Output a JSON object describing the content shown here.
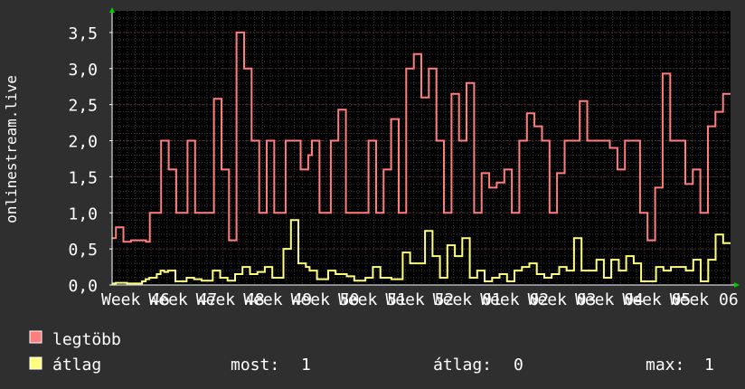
{
  "colors": {
    "background": "#2f2f2f",
    "plot_background": "#000000",
    "grid_minor": "#3a3a3a",
    "grid_major": "#4e2e2e",
    "axis": "#ffffff",
    "arrow": "#00cc00",
    "series_max": "#ff7d7d",
    "series_avg": "#ffff7d"
  },
  "chart_data": {
    "type": "line",
    "ylabel": "onlinestream.live",
    "ylim": [
      0,
      3.8
    ],
    "yticks": [
      {
        "value": 0.0,
        "label": "0,0"
      },
      {
        "value": 0.5,
        "label": "0,5"
      },
      {
        "value": 1.0,
        "label": "1,0"
      },
      {
        "value": 1.5,
        "label": "1,5"
      },
      {
        "value": 2.0,
        "label": "2,0"
      },
      {
        "value": 2.5,
        "label": "2,5"
      },
      {
        "value": 3.0,
        "label": "3,0"
      },
      {
        "value": 3.5,
        "label": "3,5"
      }
    ],
    "xticks": [
      "Week 46",
      "Week 47",
      "Week 48",
      "Week 49",
      "Week 50",
      "Week 51",
      "Week 52",
      "Week 01",
      "Week 02",
      "Week 03",
      "Week 04",
      "Week 05",
      "Week 06"
    ],
    "series": [
      {
        "name": "legtöbb",
        "color": "#ff7d7d",
        "values": [
          0.65,
          0.8,
          0.8,
          0.6,
          0.6,
          0.62,
          0.62,
          0.62,
          0.62,
          0.6,
          1.0,
          1.0,
          1.0,
          2.0,
          2.0,
          1.6,
          1.6,
          1.0,
          1.0,
          1.0,
          2.0,
          2.0,
          1.0,
          1.0,
          1.0,
          1.0,
          1.0,
          2.58,
          2.58,
          1.6,
          1.6,
          0.62,
          0.62,
          3.5,
          3.5,
          3.0,
          3.0,
          2.0,
          2.0,
          1.0,
          1.0,
          2.0,
          2.0,
          1.0,
          1.0,
          1.0,
          2.0,
          2.0,
          2.0,
          2.0,
          1.6,
          1.6,
          1.8,
          2.0,
          2.0,
          1.0,
          1.0,
          1.0,
          2.0,
          2.0,
          2.43,
          2.43,
          1.0,
          1.0,
          1.0,
          1.0,
          1.0,
          1.0,
          2.0,
          2.0,
          1.0,
          1.0,
          1.6,
          1.6,
          2.3,
          2.3,
          1.0,
          1.0,
          3.0,
          3.0,
          3.2,
          3.2,
          2.6,
          2.6,
          3.0,
          3.0,
          2.0,
          2.0,
          1.0,
          1.0,
          2.65,
          2.65,
          2.0,
          2.0,
          2.8,
          2.8,
          1.0,
          1.0,
          1.55,
          1.55,
          1.35,
          1.35,
          1.42,
          1.42,
          1.6,
          1.6,
          1.0,
          1.0,
          2.0,
          2.0,
          2.38,
          2.38,
          2.2,
          2.2,
          2.0,
          2.0,
          1.0,
          1.0,
          1.55,
          1.55,
          2.0,
          2.0,
          2.0,
          2.0,
          2.55,
          2.55,
          2.0,
          2.0,
          2.0,
          2.0,
          2.0,
          2.0,
          1.9,
          1.9,
          1.6,
          1.6,
          2.0,
          2.0,
          2.0,
          2.0,
          1.0,
          1.0,
          0.62,
          0.62,
          1.35,
          1.35,
          2.93,
          2.93,
          2.0,
          2.0,
          2.0,
          2.0,
          1.4,
          1.4,
          1.6,
          1.6,
          1.0,
          1.0,
          2.2,
          2.2,
          2.4,
          2.4,
          2.65,
          2.65
        ]
      },
      {
        "name": "átlag",
        "color": "#ffff7d",
        "values": [
          0.02,
          0.03,
          0.03,
          0.03,
          0.02,
          0.02,
          0.02,
          0.02,
          0.05,
          0.08,
          0.1,
          0.1,
          0.15,
          0.2,
          0.18,
          0.2,
          0.2,
          0.05,
          0.05,
          0.05,
          0.1,
          0.1,
          0.08,
          0.08,
          0.06,
          0.06,
          0.06,
          0.2,
          0.2,
          0.1,
          0.1,
          0.06,
          0.06,
          0.15,
          0.15,
          0.25,
          0.25,
          0.15,
          0.15,
          0.18,
          0.18,
          0.25,
          0.25,
          0.1,
          0.1,
          0.1,
          0.5,
          0.5,
          0.9,
          0.9,
          0.3,
          0.3,
          0.25,
          0.2,
          0.2,
          0.08,
          0.08,
          0.08,
          0.2,
          0.2,
          0.15,
          0.15,
          0.15,
          0.12,
          0.12,
          0.06,
          0.06,
          0.06,
          0.1,
          0.1,
          0.25,
          0.25,
          0.1,
          0.1,
          0.1,
          0.08,
          0.08,
          0.08,
          0.45,
          0.45,
          0.3,
          0.3,
          0.3,
          0.3,
          0.75,
          0.75,
          0.4,
          0.4,
          0.1,
          0.1,
          0.55,
          0.55,
          0.4,
          0.4,
          0.65,
          0.65,
          0.1,
          0.1,
          0.2,
          0.2,
          0.05,
          0.05,
          0.1,
          0.1,
          0.15,
          0.15,
          0.05,
          0.05,
          0.2,
          0.2,
          0.25,
          0.25,
          0.3,
          0.3,
          0.15,
          0.15,
          0.1,
          0.1,
          0.15,
          0.15,
          0.25,
          0.25,
          0.2,
          0.2,
          0.65,
          0.65,
          0.2,
          0.2,
          0.2,
          0.2,
          0.35,
          0.35,
          0.1,
          0.1,
          0.35,
          0.35,
          0.2,
          0.2,
          0.4,
          0.4,
          0.3,
          0.3,
          0.05,
          0.05,
          0.05,
          0.05,
          0.25,
          0.25,
          0.2,
          0.2,
          0.25,
          0.25,
          0.25,
          0.25,
          0.2,
          0.2,
          0.35,
          0.35,
          0.05,
          0.05,
          0.35,
          0.35,
          0.7,
          0.7,
          0.58,
          0.58
        ]
      }
    ]
  },
  "legend": {
    "max_label": "legtöbb",
    "avg_label": "átlag",
    "now_label": "most:",
    "now_value": "1",
    "avg_stat_label": "átlag:",
    "avg_stat_value": "0",
    "max_stat_label": "max:",
    "max_stat_value": "1"
  }
}
